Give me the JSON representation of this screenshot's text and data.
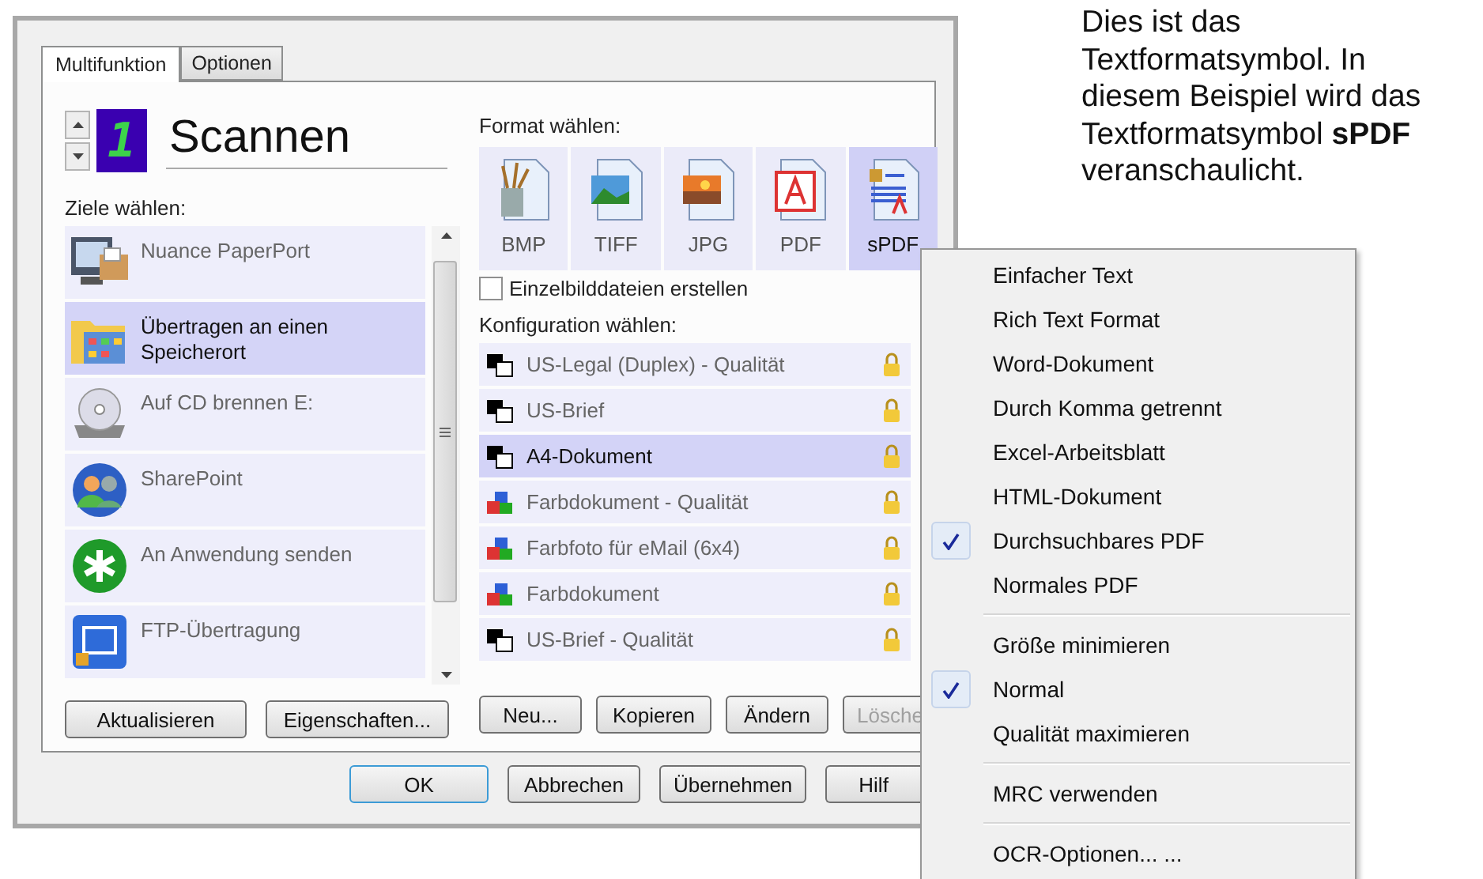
{
  "dialog": {
    "tabs": [
      {
        "label": "Multifunktion",
        "selected": true
      },
      {
        "label": "Optionen",
        "selected": false
      }
    ],
    "counter": "1",
    "title": "Scannen",
    "destinations_label": "Ziele wählen:",
    "destinations": [
      {
        "label": "Nuance PaperPort",
        "kind": "paperport",
        "selected": false
      },
      {
        "label": "Übertragen an einen Speicherort",
        "kind": "folder",
        "selected": true
      },
      {
        "label": "Auf CD brennen  E:",
        "kind": "cd",
        "selected": false
      },
      {
        "label": "SharePoint",
        "kind": "sharepoint",
        "selected": false
      },
      {
        "label": "An Anwendung senden",
        "kind": "app",
        "selected": false
      },
      {
        "label": "FTP-Übertragung",
        "kind": "ftp",
        "selected": false
      }
    ],
    "left_buttons": [
      {
        "label": "Aktualisieren",
        "disabled": false
      },
      {
        "label": "Eigenschaften...",
        "disabled": false
      }
    ],
    "format_label": "Format wählen:",
    "formats": [
      {
        "label": "BMP",
        "kind": "bmp",
        "selected": false
      },
      {
        "label": "TIFF",
        "kind": "tiff",
        "selected": false
      },
      {
        "label": "JPG",
        "kind": "jpg",
        "selected": false
      },
      {
        "label": "PDF",
        "kind": "pdf",
        "selected": false
      },
      {
        "label": "sPDF",
        "kind": "spdf",
        "selected": true
      }
    ],
    "single_files": {
      "label": "Einzelbilddateien erstellen",
      "checked": false
    },
    "config_label": "Konfiguration wählen:",
    "configs": [
      {
        "label": "US-Legal (Duplex) - Qualität",
        "kind": "mono",
        "selected": false
      },
      {
        "label": "US-Brief",
        "kind": "mono",
        "selected": false
      },
      {
        "label": "A4-Dokument",
        "kind": "mono",
        "selected": true
      },
      {
        "label": "Farbdokument - Qualität",
        "kind": "color",
        "selected": false
      },
      {
        "label": "Farbfoto für eMail (6x4)",
        "kind": "color",
        "selected": false
      },
      {
        "label": "Farbdokument",
        "kind": "color",
        "selected": false
      },
      {
        "label": "US-Brief - Qualität",
        "kind": "mono",
        "selected": false
      }
    ],
    "config_buttons": [
      {
        "label": "Neu...",
        "disabled": false
      },
      {
        "label": "Kopieren",
        "disabled": false
      },
      {
        "label": "Ändern",
        "disabled": false
      },
      {
        "label": "Lösche",
        "disabled": true
      }
    ],
    "footer_buttons": [
      {
        "label": "OK",
        "default": true
      },
      {
        "label": "Abbrechen",
        "default": false
      },
      {
        "label": "Übernehmen",
        "default": false
      },
      {
        "label": "Hilf",
        "default": false
      }
    ]
  },
  "menu": {
    "groups": [
      [
        {
          "label": "Einfacher Text",
          "checked": false
        },
        {
          "label": "Rich Text Format",
          "checked": false
        },
        {
          "label": "Word-Dokument",
          "checked": false
        },
        {
          "label": "Durch Komma getrennt",
          "checked": false
        },
        {
          "label": "Excel-Arbeitsblatt",
          "checked": false
        },
        {
          "label": "HTML-Dokument",
          "checked": false
        },
        {
          "label": "Durchsuchbares PDF",
          "checked": true
        },
        {
          "label": "Normales PDF",
          "checked": false
        }
      ],
      [
        {
          "label": "Größe minimieren",
          "checked": false
        },
        {
          "label": "Normal",
          "checked": true
        },
        {
          "label": "Qualität maximieren",
          "checked": false
        }
      ],
      [
        {
          "label": "MRC verwenden",
          "checked": false
        }
      ],
      [
        {
          "label": "OCR-Optionen... ...",
          "checked": false
        }
      ]
    ]
  },
  "caption": "Dies ist das Textformatsymbol. In diesem Beispiel wird das Textformatsymbol **sPDF** veranschaulicht."
}
